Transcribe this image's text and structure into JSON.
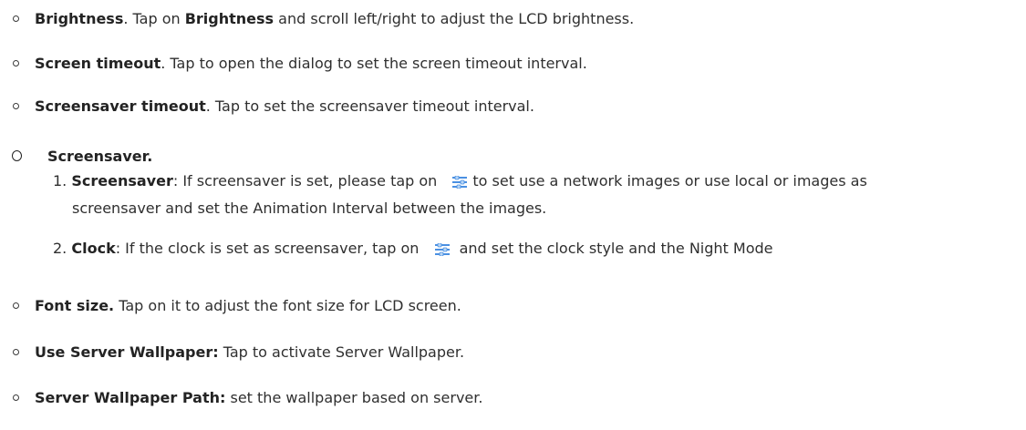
{
  "items": [
    {
      "title": "Brightness",
      "sep": ". Tap on ",
      "bold2": "Brightness",
      "rest": " and scroll left/right to adjust the LCD brightness."
    },
    {
      "title": "Screen timeout",
      "rest": ". Tap to open the dialog to set the screen timeout interval."
    },
    {
      "title": "Screensaver timeout",
      "rest": ". Tap to set the screensaver timeout interval."
    }
  ],
  "screensaver_section": {
    "title": "Screensaver.",
    "sub1": {
      "num": "1. ",
      "bold": "Screensaver",
      "text_before_icon": ": If screensaver is set, please tap on ",
      "text_after_icon": "to set use a network images or use local or images as",
      "continuation": "screensaver and set the Animation Interval between the images."
    },
    "sub2": {
      "num": "2. ",
      "bold": "Clock",
      "text_before_icon": ": If the clock is set as screensaver, tap on ",
      "text_after_icon": " and set the clock style and the Night Mode"
    }
  },
  "items_after": [
    {
      "title": "Font size.",
      "rest": " Tap on it to adjust the font size for LCD screen."
    },
    {
      "title": "Use Server Wallpaper:",
      "rest": " Tap to activate Server Wallpaper."
    },
    {
      "title": "Server Wallpaper Path:",
      "rest": " set the wallpaper based on server."
    }
  ],
  "icon_names": [
    "settings-sliders-icon"
  ],
  "colors": {
    "text": "#2f2f2f",
    "icon_blue": "#4a90e2",
    "icon_light": "#b9d6f5"
  }
}
